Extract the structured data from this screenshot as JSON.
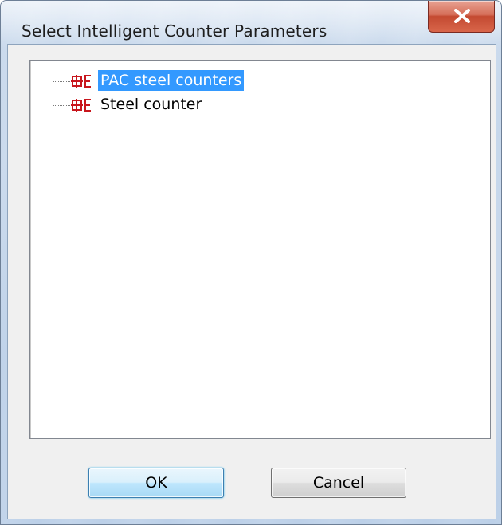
{
  "window": {
    "title": "Select Intelligent Counter Parameters",
    "close_label": "X"
  },
  "tree": {
    "items": [
      {
        "label": "PAC steel counters",
        "icon": "steel-counter-icon",
        "selected": true
      },
      {
        "label": "Steel counter",
        "icon": "steel-counter-icon",
        "selected": false
      }
    ]
  },
  "buttons": {
    "ok_label": "OK",
    "cancel_label": "Cancel"
  },
  "colors": {
    "selection": "#3399ff",
    "icon_red": "#c8161d",
    "close_red": "#c44a31"
  }
}
